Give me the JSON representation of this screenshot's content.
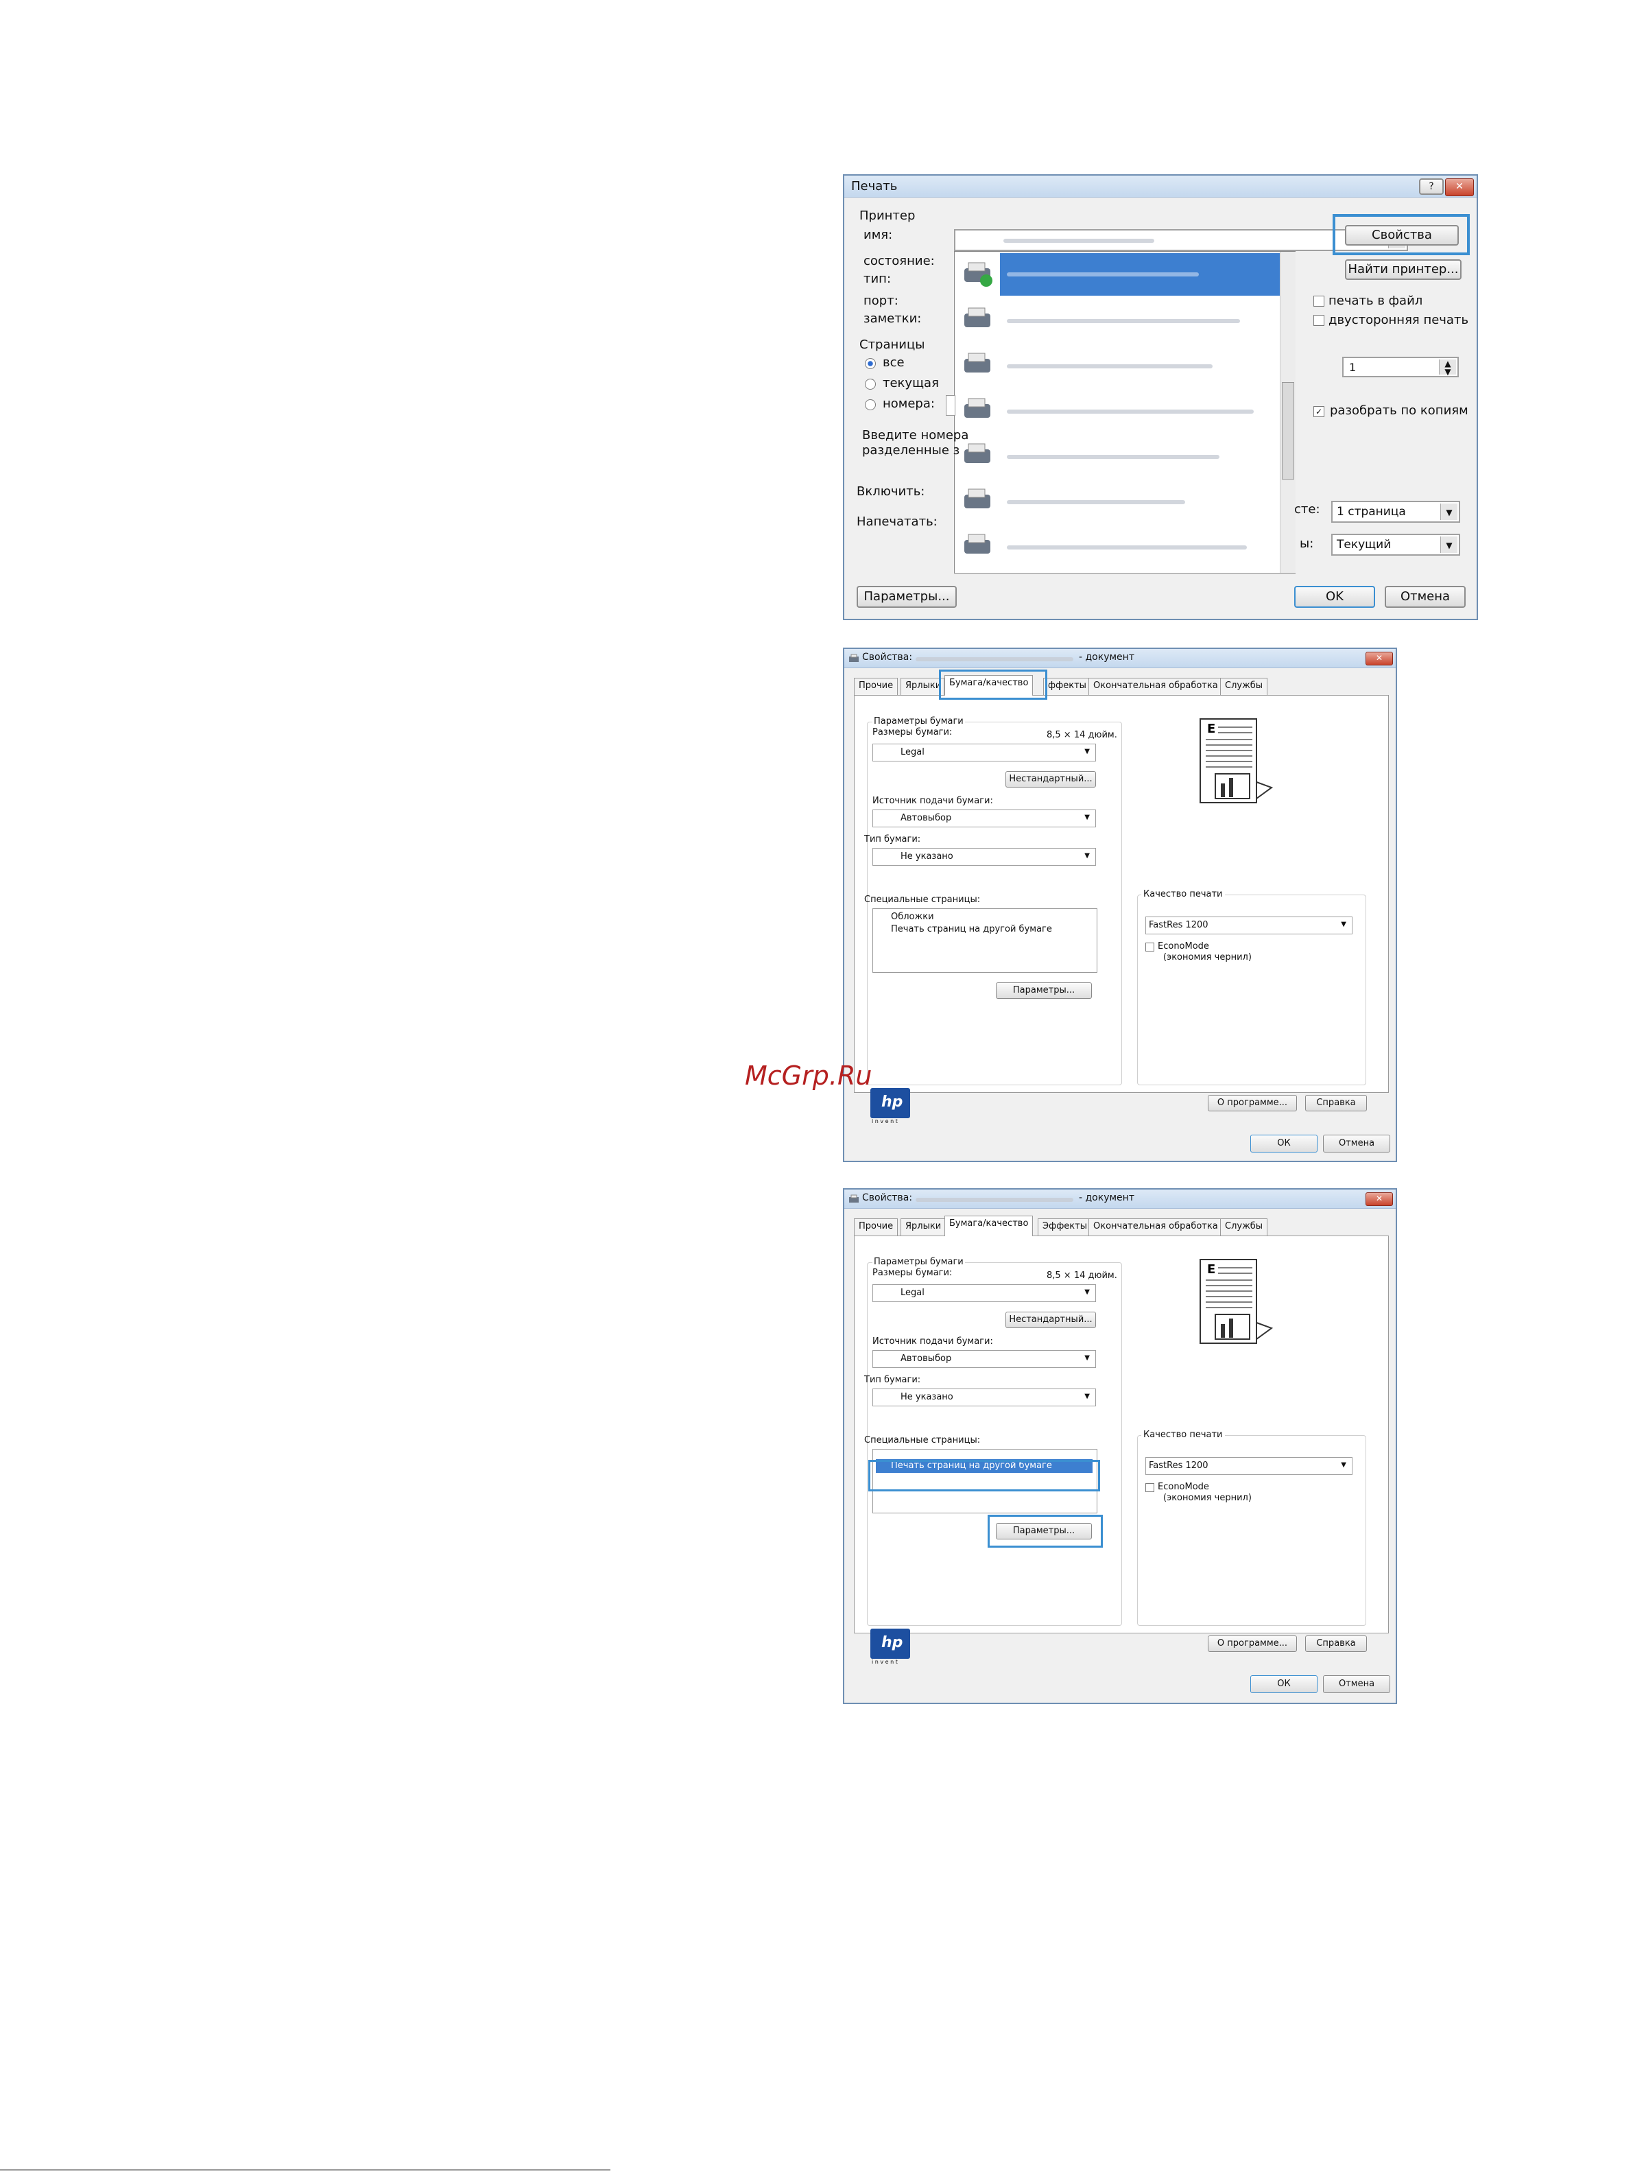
{
  "print_dialog": {
    "title": "Печать",
    "help_icon": "?",
    "close_icon": "✕",
    "printer_group": "Принтер",
    "name_label": "имя:",
    "status_label": "состояние:",
    "type_label": "тип:",
    "port_label": "порт:",
    "notes_label": "заметки:",
    "properties_button": "Свойства",
    "find_printer_button": "Найти принтер...",
    "print_to_file": "печать в файл",
    "duplex": "двусторонняя печать",
    "pages_group": "Страницы",
    "all": "все",
    "current": "текущая",
    "pages": "номера:",
    "hint_line1": "Введите номера",
    "hint_line2": "разделенные з",
    "copies_value": "1",
    "collate": "разобрать по копиям",
    "include_label": "Включить:",
    "print_label": "Напечатать:",
    "per_sheet_label": "сте:",
    "per_sheet_value": "1 страница",
    "scale_label": "ы:",
    "scale_value": "Текущий",
    "options_button": "Параметры...",
    "ok_button": "OK",
    "cancel_button": "Отмена"
  },
  "props1": {
    "title_prefix": "Свойства:",
    "title_suffix": "- документ",
    "tabs": [
      "Прочие",
      "Ярлыки",
      "Бумага/качество",
      "ффекты",
      "Окончательная обработка",
      "Службы"
    ],
    "paper_options": "Параметры бумаги",
    "paper_sizes": "Размеры бумаги:",
    "size_value": "8,5 × 14 дюйм.",
    "paper_size": "Legal",
    "custom_button": "Нестандартный...",
    "paper_source_label": "Источник подачи бумаги:",
    "paper_source": "Автовыбор",
    "paper_type_label": "Тип бумаги:",
    "paper_type": "Не указано",
    "special_pages_label": "Специальные страницы:",
    "special_pages": [
      "Обложки",
      "Печать страниц на другой бумаге"
    ],
    "params_button": "Параметры...",
    "print_quality_group": "Качество печати",
    "print_quality": "FastRes 1200",
    "economode": "EconoMode",
    "economode_note": "(экономия чернил)",
    "about_button": "О программе...",
    "help_button": "Справка",
    "ok_button": "ОК",
    "cancel_button": "Отмена",
    "hp_logo": "hp",
    "invent": "i n v e n t"
  },
  "props2": {
    "title_prefix": "Свойства:",
    "title_suffix": "- документ",
    "tabs": [
      "Прочие",
      "Ярлыки",
      "Бумага/качество",
      "Эффекты",
      "Окончательная обработка",
      "Службы"
    ],
    "paper_options": "Параметры бумаги",
    "paper_sizes": "Размеры бумаги:",
    "size_value": "8,5 × 14 дюйм.",
    "paper_size": "Legal",
    "custom_button": "Нестандартный...",
    "paper_source_label": "Источник подачи бумаги:",
    "paper_source": "Автовыбор",
    "paper_type_label": "Тип бумаги:",
    "paper_type": "Не указано",
    "special_pages_label": "Специальные страницы:",
    "special_pages_selected": "Печать страниц на другой бумаге",
    "params_button": "Параметры...",
    "print_quality_group": "Качество печати",
    "print_quality": "FastRes 1200",
    "economode": "EconoMode",
    "economode_note": "(экономия чернил)",
    "about_button": "О программе...",
    "help_button": "Справка",
    "ok_button": "ОК",
    "cancel_button": "Отмена",
    "hp_logo": "hp",
    "invent": "i n v e n t"
  },
  "watermark": "McGrp.Ru",
  "colors": {
    "highlight": "#3b8fd1",
    "selection": "#3d7fd0",
    "watermark": "#b52020"
  }
}
